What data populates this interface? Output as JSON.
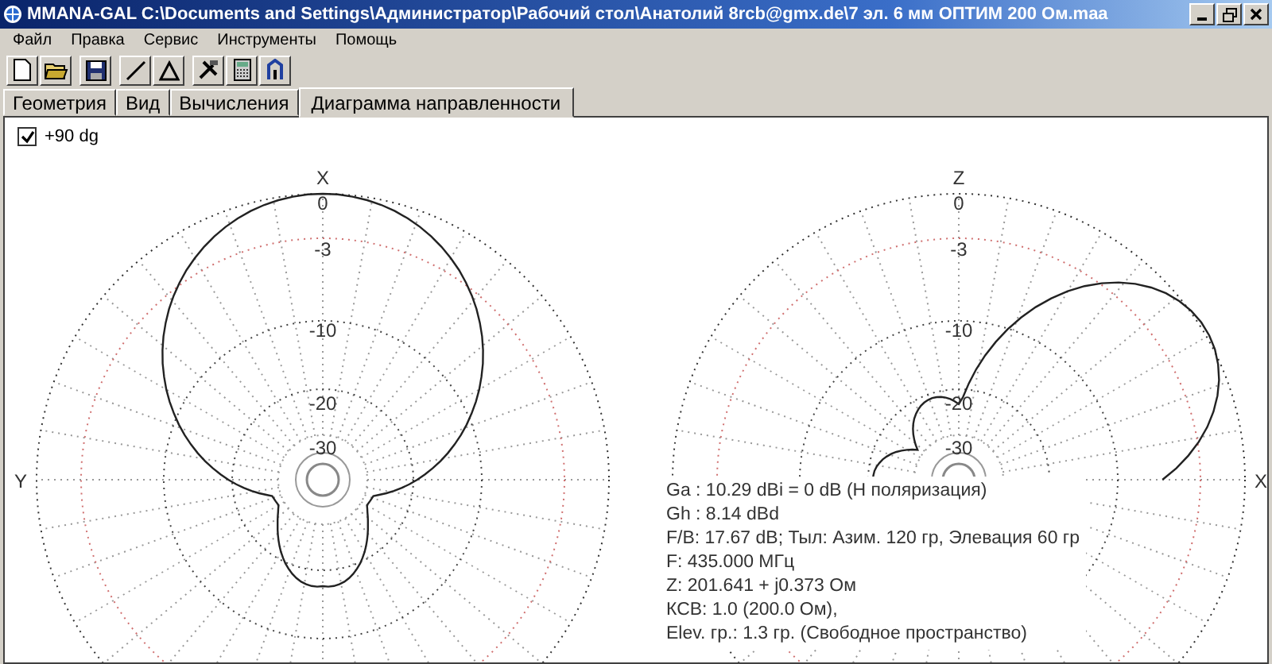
{
  "window": {
    "title": "MMANA-GAL C:\\Documents and Settings\\Администратор\\Рабочий стол\\Анатолий 8rcb@gmx.de\\7 эл. 6 мм ОПТИМ 200 Ом.maa"
  },
  "menu": [
    "Файл",
    "Правка",
    "Сервис",
    "Инструменты",
    "Помощь"
  ],
  "tabs": [
    {
      "label": "Геометрия",
      "selected": false
    },
    {
      "label": "Вид",
      "selected": false
    },
    {
      "label": "Вычисления",
      "selected": false
    },
    {
      "label": "Диаграмма направленности",
      "selected": true
    }
  ],
  "checkbox": {
    "label": "+90 dg",
    "checked": true
  },
  "plots": [
    {
      "kind": "azimuth",
      "axis_top": "X",
      "axis_side": "Y",
      "ring_labels": [
        "0",
        "-3",
        "-10",
        "-20",
        "-30"
      ]
    },
    {
      "kind": "elevation",
      "axis_top": "Z",
      "axis_side": "X",
      "ring_labels": [
        "0",
        "-3",
        "-10",
        "-20",
        "-30"
      ]
    }
  ],
  "info": [
    "Ga : 10.29 dBi = 0 dB  (H поляризация)",
    "Gh : 8.14 dBd",
    "F/B: 17.67 dB; Тыл: Азим. 120 гр, Элевация 60 гр",
    "F: 435.000 МГц",
    "Z: 201.641 + j0.373 Ом",
    "КСВ: 1.0 (200.0 Ом),",
    "Elev. гр.: 1.3 гр. (Свободное пространство)"
  ]
}
